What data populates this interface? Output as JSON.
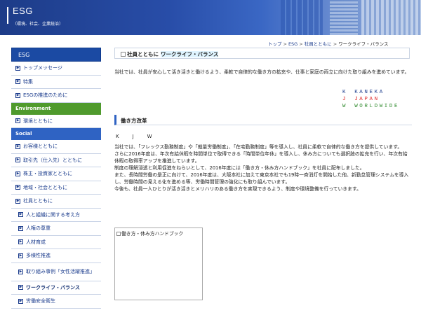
{
  "header": {
    "title": "ESG",
    "subtitle": "（環境、社会、企業統治）"
  },
  "breadcrumb": [
    {
      "label": "トップ",
      "link": true
    },
    {
      "label": "ESG",
      "link": true
    },
    {
      "label": "社員とともに",
      "link": true
    },
    {
      "label": "ワークライフ・バランス",
      "link": false
    }
  ],
  "breadcrumb_sep": ">",
  "sidebar": {
    "heading": "ESG",
    "top_items": [
      "トップメッセージ",
      "特集",
      "ESGの推進のために"
    ],
    "env_label": "Environment",
    "env_items": [
      "環境とともに"
    ],
    "social_label": "Social",
    "social_items": [
      "お客様とともに",
      "取引先（仕入先）とともに",
      "株主・投資家とともに",
      "地域・社会とともに",
      "社員とともに"
    ],
    "sub_items": [
      "人と組織に関する考え方",
      "人権の尊重",
      "人材育成",
      "多様性推進",
      "取り組み事例「女性活躍推進」",
      "ワークライフ・バランス",
      "労働安全衛生"
    ]
  },
  "page": {
    "title_prefix": "社員とともに",
    "title": "ワークライフ・バランス",
    "intro": "当社では、社員が安心して活き活きと働けるよう、柔軟で自律的な働き方の拡充や、仕事と家庭の両立に向けた取り組みを進めています。",
    "kaneka_lines": [
      "K　KANEKA",
      "J　JAPAN",
      "W　WORLDWIDE"
    ],
    "section_heading": "働き方改革",
    "kjw": "K　J　W",
    "paragraphs": [
      "当社では、「フレックス勤務制度」や「裁量労働制度」、「在宅勤務制度」等を導入し、社員に柔軟で自律的な働き方を提供しています。",
      "さらに2016年度は、年次有給休暇を時間単位で取得できる「時間単位年休」を導入し、休み方についても選択肢の拡充を行い、年次有給休暇の取得率アップを推進しています。",
      "制度の理解浸透と利用促進をねらいとして、2016年度には「働き方・休み方ハンドブック」を社員に配布しました。",
      "また、長時間労働の是正に向けて、2016年度は、大阪本社に加えて東京本社でも19時一斉消灯を開始した他、新勤怠管理システムを導入し、労働時間の見える化を進める等、労働時間管理の強化にも取り組んでいます。",
      "今後も、社員一人ひとりが活き活きとメリハリのある働き方を実現できるよう、制度や環境整備を行っていきます。"
    ],
    "image_alt": "働き方・休み方ハンドブック"
  },
  "colors": {
    "brand_blue": "#1b4aa3",
    "env_green": "#4f9a2d",
    "social_blue": "#2f63c3",
    "accent_red": "#dd2222"
  }
}
